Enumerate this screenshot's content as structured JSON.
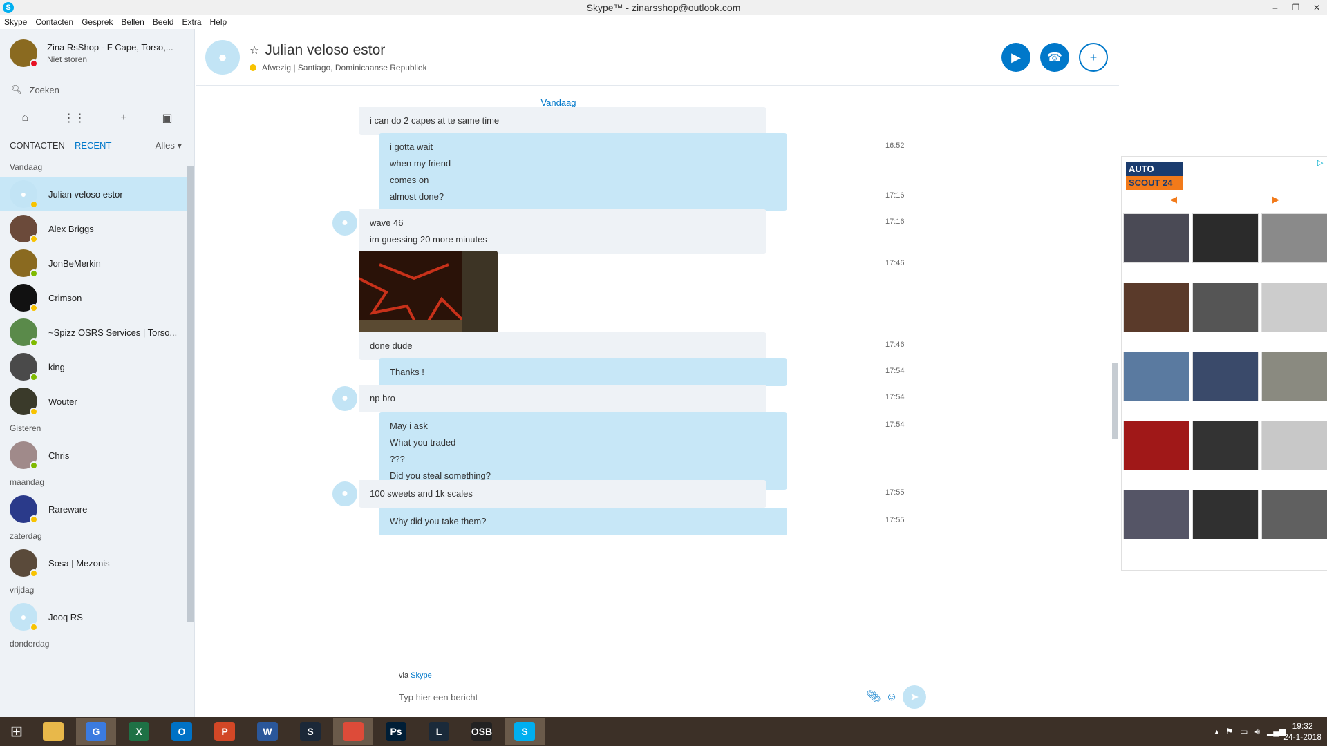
{
  "window": {
    "title": "Skype™ - zinarsshop@outlook.com",
    "app_icon": "S"
  },
  "menu": [
    "Skype",
    "Contacten",
    "Gesprek",
    "Bellen",
    "Beeld",
    "Extra",
    "Help"
  ],
  "profile": {
    "name": "Zina RsShop - F Cape, Torso,...",
    "status": "Niet storen"
  },
  "search": {
    "placeholder": "Zoeken"
  },
  "tabs": {
    "contacts": "CONTACTEN",
    "recent": "RECENT",
    "filter": "Alles"
  },
  "contacts": [
    {
      "type": "label",
      "text": "Vandaag"
    },
    {
      "type": "contact",
      "name": "Julian veloso estor",
      "status_color": "#f8c300",
      "avatar_color": "#c2e4f5",
      "active": true,
      "default_avatar": true
    },
    {
      "type": "contact",
      "name": "Alex Briggs",
      "status_color": "#f8c300",
      "avatar_color": "#6b4a3a"
    },
    {
      "type": "contact",
      "name": "JonBeMerkin",
      "status_color": "#7fba00",
      "avatar_color": "#8a6a20"
    },
    {
      "type": "contact",
      "name": "Crimson",
      "status_color": "#f8c300",
      "avatar_color": "#111111"
    },
    {
      "type": "contact",
      "name": "~Spizz OSRS Services | Torso...",
      "status_color": "#7fba00",
      "avatar_color": "#5a8a4a"
    },
    {
      "type": "contact",
      "name": "king",
      "status_color": "#7fba00",
      "avatar_color": "#4a4a4a"
    },
    {
      "type": "contact",
      "name": "Wouter",
      "status_color": "#f8c300",
      "avatar_color": "#3a3a2a"
    },
    {
      "type": "label",
      "text": "Gisteren"
    },
    {
      "type": "contact",
      "name": "Chris",
      "status_color": "#7fba00",
      "avatar_color": "#a08a8a"
    },
    {
      "type": "label",
      "text": "maandag"
    },
    {
      "type": "contact",
      "name": "Rareware",
      "status_color": "#f8c300",
      "avatar_color": "#2a3a8a"
    },
    {
      "type": "label",
      "text": "zaterdag"
    },
    {
      "type": "contact",
      "name": "Sosa | Mezonis",
      "status_color": "#f8c300",
      "avatar_color": "#5a4a3a"
    },
    {
      "type": "label",
      "text": "vrijdag"
    },
    {
      "type": "contact",
      "name": "Jooq RS",
      "status_color": "#f8c300",
      "avatar_color": "#c2e4f5",
      "default_avatar": true
    },
    {
      "type": "label",
      "text": "donderdag"
    }
  ],
  "chat": {
    "name": "Julian veloso estor",
    "status": "Afwezig",
    "location": "Santiago, Dominicaanse Republiek",
    "day_label": "Vandaag",
    "via": "via",
    "via_link": "Skype",
    "input_placeholder": "Typ hier een bericht"
  },
  "messages": [
    {
      "dir": "in",
      "lines": [
        "i can do 2 capes at te same time"
      ],
      "time": ""
    },
    {
      "dir": "out",
      "lines": [
        "i gotta wait",
        "when my friend",
        "comes on"
      ],
      "time": "16:52"
    },
    {
      "dir": "out",
      "lines": [
        "almost done?"
      ],
      "time": "17:16"
    },
    {
      "dir": "in",
      "lines": [
        "wave 46",
        "im guessing 20 more minutes"
      ],
      "time": "17:16",
      "avatar": true
    },
    {
      "dir": "image",
      "lines": [],
      "time": "17:46"
    },
    {
      "dir": "in",
      "lines": [
        "done dude"
      ],
      "time": "17:46"
    },
    {
      "dir": "out",
      "lines": [
        "Thanks !"
      ],
      "time": "17:54"
    },
    {
      "dir": "in",
      "lines": [
        "np bro"
      ],
      "time": "17:54",
      "avatar": true
    },
    {
      "dir": "out",
      "lines": [
        "May i ask",
        "What you traded",
        "???",
        "Did you steal something?"
      ],
      "time": "17:54"
    },
    {
      "dir": "in",
      "lines": [
        "100 sweets and 1k scales"
      ],
      "time": "17:55",
      "avatar": true
    },
    {
      "dir": "out",
      "lines": [
        "Why did you take them?"
      ],
      "time": "17:55"
    }
  ],
  "ad": {
    "logo_line1": "AUTO",
    "logo_line2": "SCOUT 24"
  },
  "taskbar": {
    "apps": [
      {
        "name": "file-explorer",
        "label": "",
        "color": "#e8b84a"
      },
      {
        "name": "google",
        "label": "G",
        "color": "#3b7be0",
        "active": true
      },
      {
        "name": "excel",
        "label": "X",
        "color": "#1e7145"
      },
      {
        "name": "outlook",
        "label": "O",
        "color": "#0072c6"
      },
      {
        "name": "powerpoint",
        "label": "P",
        "color": "#d24726"
      },
      {
        "name": "word",
        "label": "W",
        "color": "#2b579a"
      },
      {
        "name": "steam",
        "label": "S",
        "color": "#1b2838"
      },
      {
        "name": "chrome",
        "label": "",
        "color": "#dd4b39",
        "active": true
      },
      {
        "name": "photoshop",
        "label": "Ps",
        "color": "#001e36"
      },
      {
        "name": "league",
        "label": "L",
        "color": "#1a2a3a"
      },
      {
        "name": "osbuddy",
        "label": "OSB",
        "color": "#222222"
      },
      {
        "name": "skype",
        "label": "S",
        "color": "#00aff0",
        "active": true
      }
    ],
    "time": "19:32",
    "date": "24-1-2018"
  }
}
